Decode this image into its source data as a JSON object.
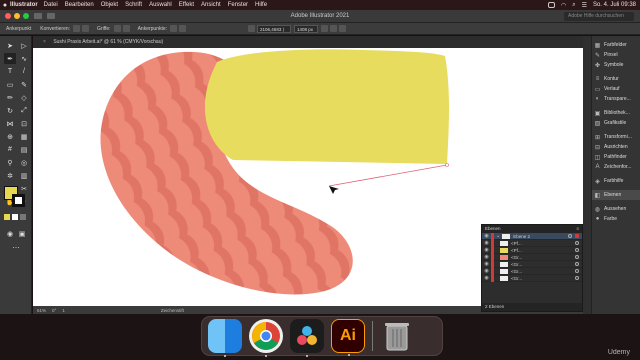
{
  "menubar": {
    "apple": "",
    "app": "Illustrator",
    "items": [
      "Datei",
      "Bearbeiten",
      "Objekt",
      "Schrift",
      "Auswahl",
      "Effekt",
      "Ansicht",
      "Fenster",
      "Hilfe"
    ],
    "datetime": "So. 4. Juli 09:38"
  },
  "appbar": {
    "title": "Adobe Illustrator 2021",
    "search_placeholder": "Adobe Hilfe durchsuchen"
  },
  "control": {
    "anchor_label": "Ankerpunkt",
    "convert_label": "Konvertieren:",
    "handles_label": "Griffe:",
    "anchors_label": "Ankerpunkte:",
    "x_value": "2106,4683 ⟩",
    "y_value": "1408 px"
  },
  "document": {
    "tab": "Sushi Praxis Arbeit.ai* @ 61 % (CMYK/Vorschau)"
  },
  "status": {
    "zoom": "61%",
    "angle": "0°",
    "artboard": "1",
    "tool": "Zeichenstift"
  },
  "panels": [
    {
      "icon": "brush",
      "label": "Farbfelder"
    },
    {
      "icon": "brush",
      "label": "Pinsel"
    },
    {
      "icon": "symbol",
      "label": "Symbole"
    },
    {
      "icon": "stroke",
      "label": "Kontur"
    },
    {
      "icon": "gradient",
      "label": "Verlauf"
    },
    {
      "icon": "transparency",
      "label": "Transpare..."
    },
    {
      "icon": "library",
      "label": "Bibliothek..."
    },
    {
      "icon": "graphic",
      "label": "Grafikstile"
    },
    {
      "icon": "transform",
      "label": "Transformi..."
    },
    {
      "icon": "align",
      "label": "Ausrichten"
    },
    {
      "icon": "pathfinder",
      "label": "Pathfinder"
    },
    {
      "icon": "char",
      "label": "Zeichenfor..."
    },
    {
      "icon": "color",
      "label": "Farbhilfe"
    },
    {
      "icon": "layers",
      "label": "Ebenen"
    },
    {
      "icon": "appearance",
      "label": "Aussehen"
    },
    {
      "icon": "color",
      "label": "Farbe"
    }
  ],
  "layers": {
    "title": "Ebenen",
    "parent": "Ebene 2",
    "items": [
      "<Pf...",
      "<Pf...",
      "<Gr...",
      "<Gr...",
      "<Gr...",
      "<Gr..."
    ],
    "footer": "2 Ebenen"
  },
  "dock": [
    "Finder",
    "Google Chrome",
    "DaVinci Resolve",
    "Adobe Illustrator",
    "Papierkorb"
  ],
  "colors": {
    "salmon": "#ee8a78",
    "salmon_stripe": "#e07566",
    "yellow": "#e8dc5e",
    "path": "#e06070"
  },
  "watermark": "Udemy"
}
